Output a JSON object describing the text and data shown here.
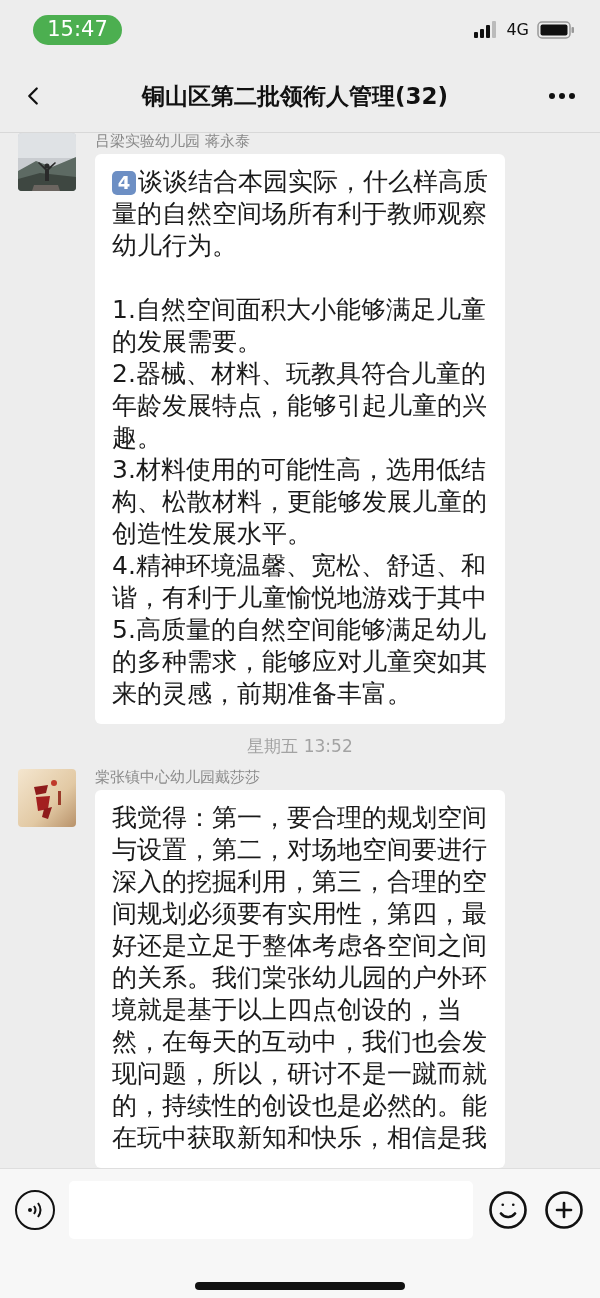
{
  "status_bar": {
    "time": "15:47",
    "network": "4G"
  },
  "nav": {
    "title": "铜山区第二批领衔人管理(32)"
  },
  "messages": [
    {
      "kind": "message",
      "sender": "吕梁实验幼儿园 蒋永泰",
      "number_badge": "4",
      "text": "谈谈结合本园实际，什么样高质量的自然空间场所有利于教师观察幼儿行为。\n\n1.自然空间面积大小能够满足儿童的发展需要。\n2.器械、材料、玩教具符合儿童的年龄发展特点，能够引起儿童的兴趣。\n3.材料使用的可能性高，选用低结构、松散材料，更能够发展儿童的创造性发展水平。\n4.精神环境温馨、宽松、舒适、和谐，有利于儿童愉悦地游戏于其中\n5.高质量的自然空间能够满足幼儿的多种需求，能够应对儿童突如其来的灵感，前期准备丰富。"
    },
    {
      "kind": "time",
      "text": "星期五 13:52"
    },
    {
      "kind": "message",
      "sender": "棠张镇中心幼儿园戴莎莎",
      "text": "我觉得：第一，要合理的规划空间与设置，第二，对场地空间要进行深入的挖掘利用，第三，合理的空间规划必须要有实用性，第四，最好还是立足于整体考虑各空间之间的关系。我们棠张幼儿园的户外环境就是基于以上四点创设的，当然，在每天的互动中，我们也会发现问题，所以，研讨不是一蹴而就的，持续性的创设也是必然的。能在玩中获取新知和快乐，相信是我"
    }
  ]
}
